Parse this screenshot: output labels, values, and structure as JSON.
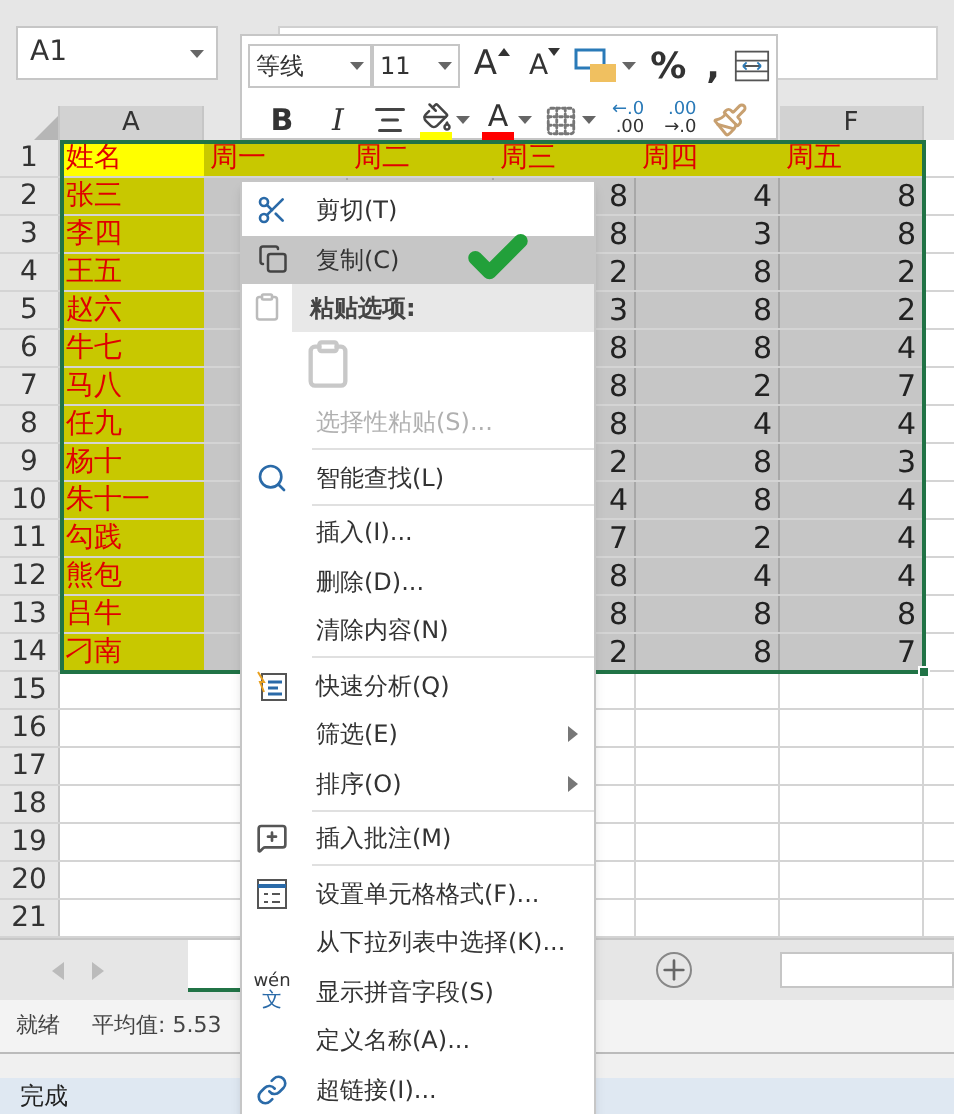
{
  "name_box": {
    "value": "A1"
  },
  "mini_toolbar": {
    "font": "等线",
    "size": "11",
    "row1": [
      {
        "kind": "grow",
        "label": "A"
      },
      {
        "kind": "shrink",
        "label": "A"
      },
      {
        "kind": "style"
      },
      {
        "kind": "text",
        "label": "%"
      },
      {
        "kind": "text",
        "label": ","
      },
      {
        "kind": "table"
      }
    ],
    "row2": [
      {
        "kind": "bold",
        "label": "B"
      },
      {
        "kind": "italic",
        "label": "I"
      },
      {
        "kind": "align"
      },
      {
        "kind": "fill",
        "color": "#ffff00"
      },
      {
        "kind": "fontcolor",
        "label": "A",
        "color": "#ff0000"
      },
      {
        "kind": "borders"
      },
      {
        "kind": "decimal",
        "top": "←.0",
        "bottom": ".00"
      },
      {
        "kind": "decimal",
        "top": ".00",
        "bottom": "→.0"
      },
      {
        "kind": "painter"
      }
    ]
  },
  "sheet": {
    "column_a_header": "A",
    "column_f_header": "F",
    "rows": [
      {
        "number": "1",
        "cells": [
          "姓名",
          "周一",
          "周二",
          "周三",
          "周四",
          "周五"
        ]
      },
      {
        "number": "2",
        "cells": [
          "张三",
          null,
          null,
          "8",
          "4",
          "8"
        ]
      },
      {
        "number": "3",
        "cells": [
          "李四",
          null,
          null,
          "8",
          "3",
          "8"
        ]
      },
      {
        "number": "4",
        "cells": [
          "王五",
          null,
          null,
          "2",
          "8",
          "2"
        ]
      },
      {
        "number": "5",
        "cells": [
          "赵六",
          null,
          null,
          "3",
          "8",
          "2"
        ]
      },
      {
        "number": "6",
        "cells": [
          "牛七",
          null,
          null,
          "8",
          "8",
          "4"
        ]
      },
      {
        "number": "7",
        "cells": [
          "马八",
          null,
          null,
          "8",
          "2",
          "7"
        ]
      },
      {
        "number": "8",
        "cells": [
          "任九",
          null,
          null,
          "8",
          "4",
          "4"
        ]
      },
      {
        "number": "9",
        "cells": [
          "杨十",
          null,
          null,
          "2",
          "8",
          "3"
        ]
      },
      {
        "number": "10",
        "cells": [
          "朱十一",
          null,
          null,
          "4",
          "8",
          "4"
        ]
      },
      {
        "number": "11",
        "cells": [
          "勾践",
          null,
          null,
          "7",
          "2",
          "4"
        ]
      },
      {
        "number": "12",
        "cells": [
          "熊包",
          null,
          null,
          "8",
          "4",
          "4"
        ]
      },
      {
        "number": "13",
        "cells": [
          "吕牛",
          null,
          null,
          "8",
          "8",
          "8"
        ]
      },
      {
        "number": "14",
        "cells": [
          "刁南",
          null,
          null,
          "2",
          "8",
          "7"
        ]
      },
      {
        "number": "15"
      },
      {
        "number": "16"
      },
      {
        "number": "17"
      },
      {
        "number": "18"
      },
      {
        "number": "19"
      },
      {
        "number": "20"
      },
      {
        "number": "21"
      }
    ]
  },
  "menu": {
    "items": [
      {
        "kind": "cut",
        "label": "剪切(T)",
        "selected": false,
        "disabled": false
      },
      {
        "kind": "copy",
        "label": "复制(C)",
        "selected": true,
        "disabled": false
      },
      {
        "kind": "paste_header",
        "label": "粘贴选项:"
      },
      {
        "kind": "paste_option"
      },
      {
        "kind": "plain",
        "label": "选择性粘贴(S)...",
        "selected": false,
        "disabled": true
      },
      {
        "kind": "separator"
      },
      {
        "kind": "lookup",
        "label": "智能查找(L)",
        "selected": false,
        "disabled": false
      },
      {
        "kind": "separator"
      },
      {
        "kind": "plain",
        "label": "插入(I)...",
        "selected": false,
        "disabled": false
      },
      {
        "kind": "plain",
        "label": "删除(D)...",
        "selected": false,
        "disabled": false
      },
      {
        "kind": "plain",
        "label": "清除内容(N)",
        "selected": false,
        "disabled": false
      },
      {
        "kind": "separator"
      },
      {
        "kind": "analysis",
        "label": "快速分析(Q)",
        "selected": false,
        "disabled": false
      },
      {
        "kind": "submenu",
        "label": "筛选(E)",
        "selected": false,
        "disabled": false
      },
      {
        "kind": "submenu",
        "label": "排序(O)",
        "selected": false,
        "disabled": false
      },
      {
        "kind": "separator"
      },
      {
        "kind": "comment",
        "label": "插入批注(M)",
        "selected": false,
        "disabled": false
      },
      {
        "kind": "separator"
      },
      {
        "kind": "format",
        "label": "设置单元格格式(F)...",
        "selected": false,
        "disabled": false
      },
      {
        "kind": "plain",
        "label": "从下拉列表中选择(K)...",
        "selected": false,
        "disabled": false
      },
      {
        "kind": "pinyin",
        "label": "显示拼音字段(S)",
        "icon_top": "wén",
        "icon_bottom": "文",
        "selected": false,
        "disabled": false
      },
      {
        "kind": "plain",
        "label": "定义名称(A)...",
        "selected": false,
        "disabled": false
      },
      {
        "kind": "link",
        "label": "超链接(I)...",
        "selected": false,
        "disabled": false
      }
    ]
  },
  "status_bar": {
    "state": "就绪",
    "average": "平均值: 5.53"
  },
  "taskbar": {
    "status": "完成"
  }
}
